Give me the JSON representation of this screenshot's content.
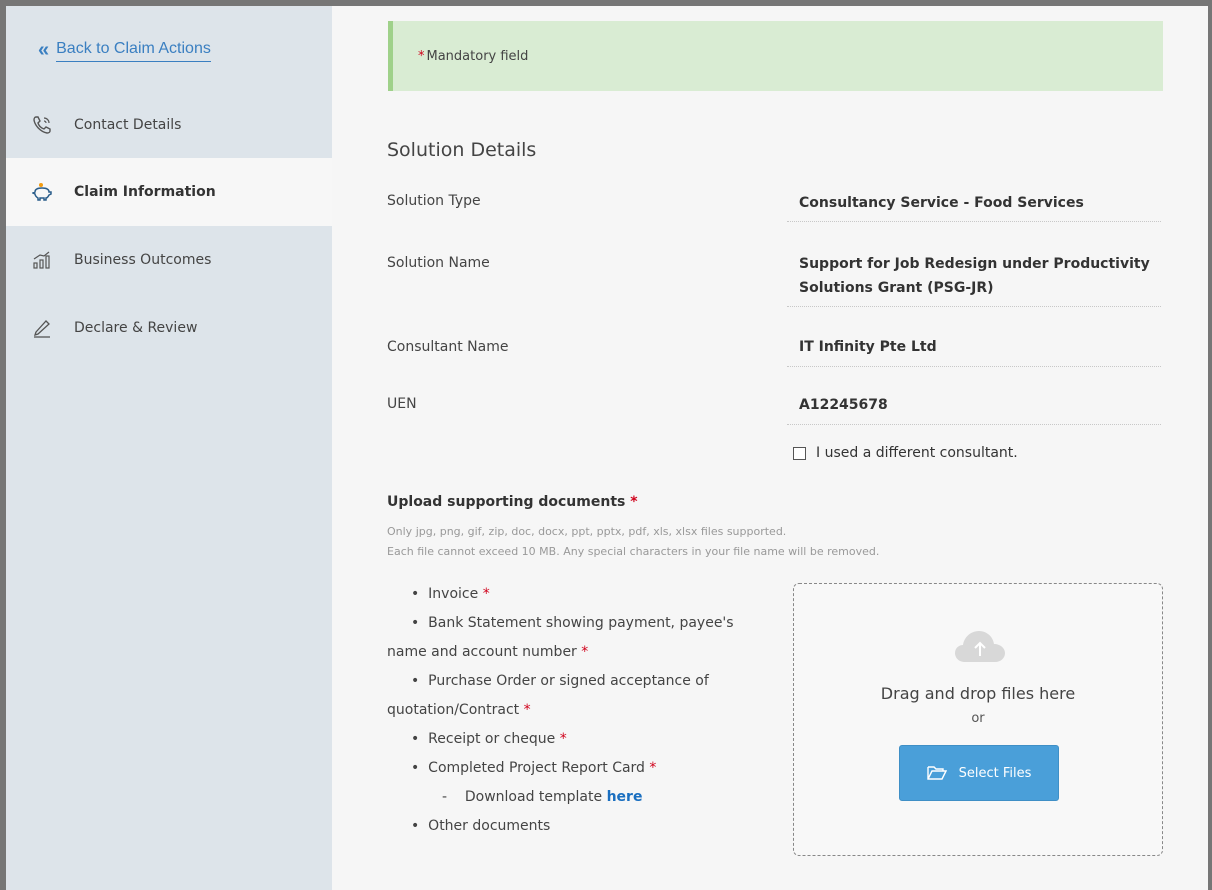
{
  "sidebar": {
    "back_label": "Back to Claim Actions",
    "items": [
      {
        "label": "Contact Details",
        "icon": "phone-icon"
      },
      {
        "label": "Claim Information",
        "icon": "piggy-bank-icon",
        "active": true
      },
      {
        "label": "Business Outcomes",
        "icon": "bar-chart-icon"
      },
      {
        "label": "Declare & Review",
        "icon": "pen-icon"
      }
    ]
  },
  "notice": {
    "star": "*",
    "text": "Mandatory field"
  },
  "solution": {
    "title": "Solution Details",
    "fields": [
      {
        "label": "Solution Type",
        "value": "Consultancy Service - Food Services"
      },
      {
        "label": "Solution Name",
        "value": "Support for Job Redesign under Productivity Solutions Grant (PSG-JR)"
      },
      {
        "label": "Consultant Name",
        "value": "IT Infinity Pte Ltd"
      },
      {
        "label": "UEN",
        "value": "A12245678"
      }
    ],
    "checkbox_label": "I used a different consultant."
  },
  "upload": {
    "title": "Upload supporting documents",
    "star": "*",
    "hint1": "Only jpg, png, gif, zip, doc, docx, ppt, pptx, pdf, xls, xlsx files supported.",
    "hint2": "Each file cannot exceed 10 MB. Any special characters in your file name will be removed.",
    "docs": {
      "invoice": "Invoice",
      "bank_1": "Bank Statement showing payment, payee's",
      "bank_2": "name and account number",
      "po_1": "Purchase Order or signed acceptance of",
      "po_2": "quotation/Contract",
      "receipt": "Receipt or cheque",
      "report": "Completed Project Report Card",
      "template_prefix": "Download template",
      "template_link": "here",
      "other": "Other documents",
      "bullet": "•",
      "dash": "-"
    },
    "dropzone": {
      "text": "Drag and drop files here",
      "or": "or",
      "button": "Select Files"
    }
  },
  "colors": {
    "accent": "#4a9fd9",
    "link": "#3a7fc1",
    "required": "#d0021b",
    "notice_bg": "#d9ecd3",
    "sidebar_bg": "#dde4ea"
  }
}
